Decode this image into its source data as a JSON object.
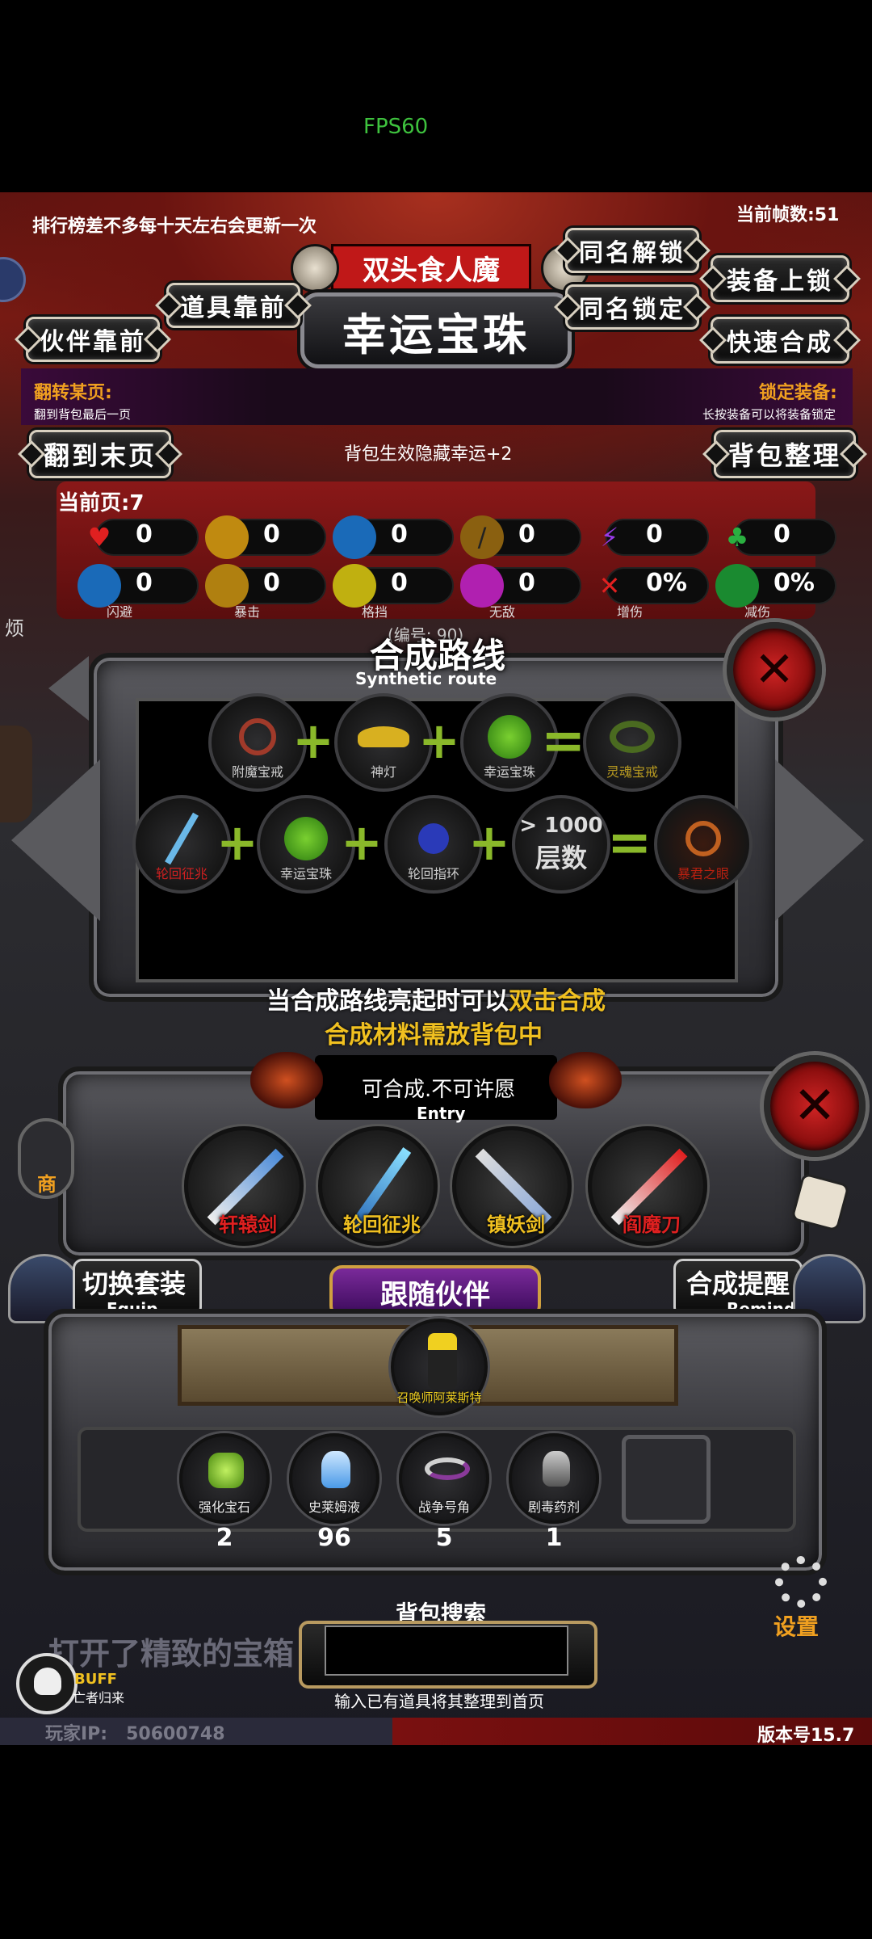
{
  "status": {
    "fps": "FPS60"
  },
  "top": {
    "notice": "排行榜差不多每十天左右会更新一次",
    "frame_count": "当前帧数:51"
  },
  "header": {
    "monster_name": "双头食人魔",
    "item_title": "幸运宝珠",
    "buttons": {
      "same_name_unlock": "同名解锁",
      "same_name_lock": "同名锁定",
      "equip_lock": "装备上锁",
      "quick_merge": "快速合成",
      "items_front": "道具靠前",
      "partner_front": "伙伴靠前",
      "flip_last": "翻到末页",
      "bag_sort": "背包整理"
    },
    "flip_page_label": "翻转某页:",
    "flip_page_hint": "翻到背包最后一页",
    "lock_equip_label": "锁定装备:",
    "lock_equip_hint": "长按装备可以将装备锁定",
    "effect_text": "背包生效隐藏幸运+2",
    "current_page": "当前页:7"
  },
  "stats": {
    "row1": [
      {
        "icon": "heart-icon",
        "value": "0",
        "color": "#e02020"
      },
      {
        "icon": "armor-icon",
        "value": "0",
        "color": "#d8a020"
      },
      {
        "icon": "helmet-icon",
        "value": "0",
        "color": "#2a8ad8"
      },
      {
        "icon": "sword-icon",
        "value": "0",
        "color": "#b08020"
      },
      {
        "icon": "lightning-icon",
        "value": "0",
        "color": "#8a3ad8"
      },
      {
        "icon": "clover-icon",
        "value": "0",
        "color": "#2ab040"
      }
    ],
    "row2": [
      {
        "icon": "dodge-icon",
        "value": "0",
        "caption": "闪避",
        "color": "#2a8ad8"
      },
      {
        "icon": "crit-icon",
        "value": "0",
        "caption": "暴击",
        "color": "#d8a020"
      },
      {
        "icon": "block-icon",
        "value": "0",
        "caption": "格挡",
        "color": "#d8c020"
      },
      {
        "icon": "invincible-icon",
        "value": "0",
        "caption": "无敌",
        "color": "#d82ad8"
      },
      {
        "icon": "damage-up-icon",
        "value": "0%",
        "caption": "增伤",
        "color": "#e02020"
      },
      {
        "icon": "damage-reduce-icon",
        "value": "0%",
        "caption": "减伤",
        "color": "#2ab040"
      }
    ]
  },
  "route": {
    "number_label": "(编号: 90)",
    "title": "合成路线",
    "subtitle": "Synthetic route",
    "recipe1": [
      "附魔宝戒",
      "神灯",
      "幸运宝珠",
      "灵魂宝戒"
    ],
    "recipe2": [
      "轮回征兆",
      "幸运宝珠",
      "轮回指环",
      "层数",
      "暴君之眼"
    ],
    "layers_value": "> 1000",
    "tip1_prefix": "当合成路线亮起时可以",
    "tip1_highlight": "双击合成",
    "tip2": "合成材料需放背包中"
  },
  "entry": {
    "text": "可合成.不可许愿",
    "label": "Entry",
    "weapons": [
      "轩辕剑",
      "轮回征兆",
      "镇妖剑",
      "阎魔刀"
    ]
  },
  "bottom": {
    "switch_equip": "切换套装",
    "switch_equip_sub": "Equip",
    "follow_partner": "跟随伙伴",
    "merge_remind": "合成提醒",
    "merge_remind_sub": "Remind",
    "partner_name": "召唤师阿莱斯特",
    "inventory": [
      {
        "name": "强化宝石",
        "count": "2"
      },
      {
        "name": "史莱姆液",
        "count": "96"
      },
      {
        "name": "战争号角",
        "count": "5"
      },
      {
        "name": "剧毒药剂",
        "count": "1"
      },
      {
        "name": "",
        "count": ""
      }
    ],
    "search_title": "背包搜索",
    "search_hint": "输入已有道具将其整理到首页",
    "log_text": "打开了精致的宝箱",
    "shop_label": "商",
    "settings_label": "设置",
    "buff_label": "BUFF",
    "buff_sub": "亡者归来",
    "player_ip": "玩家IP:   50600748",
    "version": "版本号15.7",
    "side_letter": "烦"
  }
}
